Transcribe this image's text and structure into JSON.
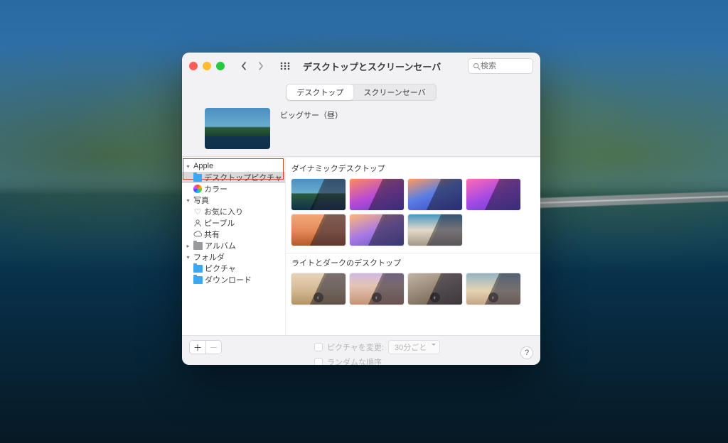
{
  "window": {
    "title": "デスクトップとスクリーンセーバ",
    "search_placeholder": "検索"
  },
  "tabs": {
    "desktop": "デスクトップ",
    "screensaver": "スクリーンセーバ",
    "selected": 0
  },
  "preview": {
    "name": "ビッグサー（昼）"
  },
  "sidebar": {
    "groups": [
      {
        "label": "Apple",
        "expanded": true,
        "items": [
          {
            "label": "デスクトップピクチャ",
            "icon": "folder",
            "selected": true
          },
          {
            "label": "カラー",
            "icon": "color"
          }
        ]
      },
      {
        "label": "写真",
        "expanded": true,
        "items": [
          {
            "label": "お気に入り",
            "icon": "heart"
          },
          {
            "label": "ピープル",
            "icon": "people"
          },
          {
            "label": "共有",
            "icon": "cloud"
          }
        ]
      },
      {
        "label": "アルバム",
        "icon": "folder-grey",
        "expanded": false,
        "items": []
      },
      {
        "label": "フォルダ",
        "expanded": true,
        "items": [
          {
            "label": "ピクチャ",
            "icon": "folder"
          },
          {
            "label": "ダウンロード",
            "icon": "folder"
          }
        ]
      }
    ]
  },
  "sections": {
    "dynamic": "ダイナミックデスクトップ",
    "lightdark": "ライトとダークのデスクトップ"
  },
  "footer": {
    "change_label": "ピクチャを変更:",
    "interval": "30分ごと",
    "random_label": "ランダムな順序"
  }
}
